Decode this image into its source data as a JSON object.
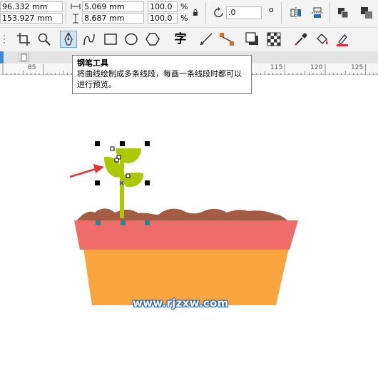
{
  "property_bar": {
    "x_value": "96.332 mm",
    "y_value": "153.927 mm",
    "width_value": "5.069 mm",
    "height_value": "8.687 mm",
    "scale_x": "100.0",
    "scale_y": "100.0",
    "percent_symbol": "%",
    "rotation_value": ".0",
    "degree_symbol": "o"
  },
  "toolbar": {
    "text_tool_glyph": "字",
    "active_tool": "pen-tool"
  },
  "ruler": {
    "ticks": [
      "85",
      "115",
      "120",
      "125"
    ]
  },
  "tooltip": {
    "title": "钢笔工具",
    "description": "将曲线绘制成多条线段，每画一条线段时都可以进行预览。"
  },
  "watermark": "www.rjzxw.com",
  "colors": {
    "pot_rim": "#ee6c69",
    "pot_body": "#f9a540",
    "soil": "#a55c45",
    "leaf": "#acc80b",
    "arrow": "#e63333",
    "handle": "#1e8c96"
  }
}
